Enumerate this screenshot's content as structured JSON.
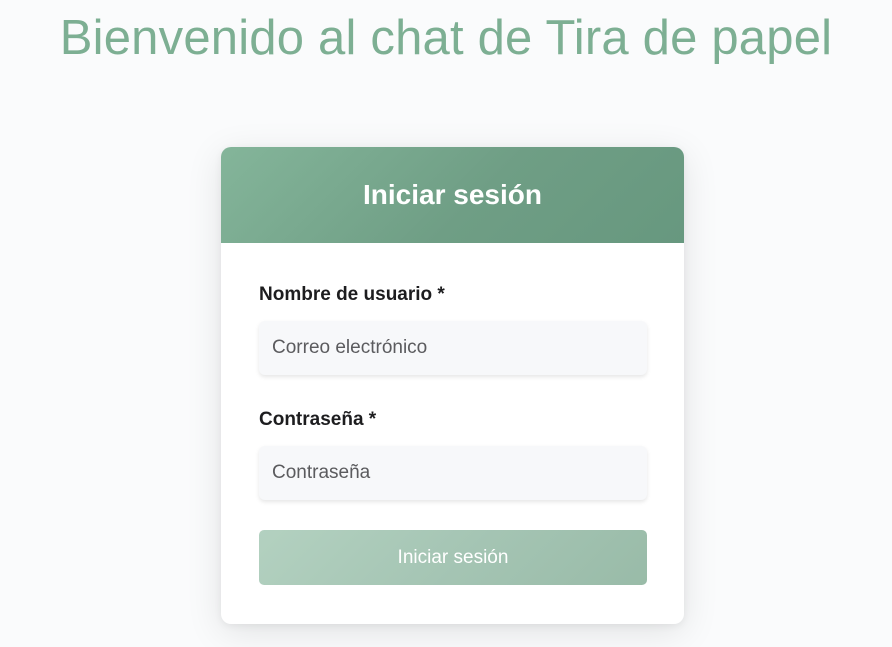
{
  "page": {
    "title": "Bienvenido al chat de Tira de papel"
  },
  "login": {
    "header_title": "Iniciar sesión",
    "username_label": "Nombre de usuario *",
    "username_placeholder": "Correo electrónico",
    "password_label": "Contraseña *",
    "password_placeholder": "Contraseña",
    "submit_label": "Iniciar sesión"
  },
  "colors": {
    "title": "#7daf93",
    "header_gradient_start": "#84b59a",
    "header_gradient_end": "#67987f",
    "button_disabled": "#a5c5b4"
  }
}
